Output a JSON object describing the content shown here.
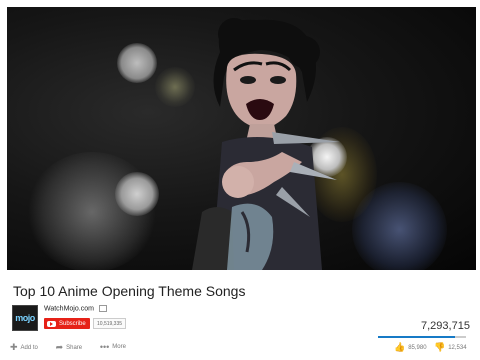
{
  "video": {
    "title": "Top 10 Anime Opening Theme Songs"
  },
  "channel": {
    "name": "WatchMojo.com",
    "logo_text": "mojo",
    "subscribe_label": "Subscribe",
    "subscriber_count": "10,519,335"
  },
  "stats": {
    "views": "7,293,715",
    "likes": "85,980",
    "dislikes": "12,534",
    "like_ratio": 0.873
  },
  "actions": {
    "add_to": "Add to",
    "share": "Share",
    "more": "More"
  },
  "icons": {
    "add": "add-icon",
    "share": "share-icon",
    "more": "more-icon",
    "like": "thumbs-up-icon",
    "dislike": "thumbs-down-icon"
  },
  "colors": {
    "subscribe": "#e62117",
    "like_bar": "#167ac6"
  }
}
